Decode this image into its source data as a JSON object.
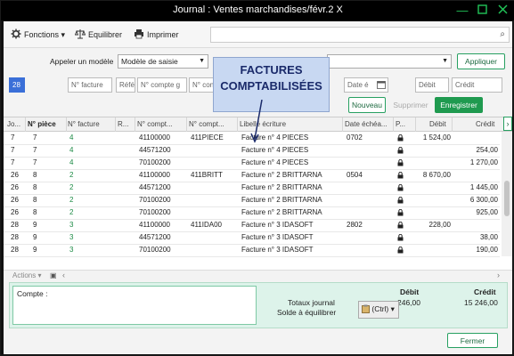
{
  "window": {
    "title": "Journal : Ventes marchandises/févr.2",
    "close_glyph": "X"
  },
  "toolbar": {
    "functions_label": "Fonctions",
    "balance_label": "Equilibrer",
    "print_label": "Imprimer"
  },
  "model": {
    "label": "Appeler un modèle",
    "selected": "Modèle de saisie",
    "apply_label": "Appliquer"
  },
  "filters": {
    "day": "28",
    "invoice_no": "N° facture",
    "reference": "Réfé",
    "account": "N° compte g",
    "account2": "N° con",
    "date": "Date é",
    "debit": "Débit",
    "credit": "Crédit"
  },
  "actions": {
    "new_label": "Nouveau",
    "delete_label": "Supprimer",
    "save_label": "Enregistrer"
  },
  "annotation": {
    "line1": "FACTURES",
    "line2": "COMPTABILISÉES"
  },
  "grid": {
    "headers": [
      "Jo...",
      "N° pièce",
      "N° facture",
      "R...",
      "N° compt...",
      "N° compt...",
      "Libellé écriture",
      "Date échéa...",
      "P...",
      "Débit",
      "Crédit"
    ],
    "rows": [
      {
        "day": "7",
        "piece": "7",
        "invoice": "4",
        "account": "41100000",
        "aux": "411PIECE",
        "label": "Facture n° 4 PIECES",
        "due": "0702",
        "debit": "1 524,00",
        "credit": ""
      },
      {
        "day": "7",
        "piece": "7",
        "invoice": "4",
        "account": "44571200",
        "aux": "",
        "label": "Facture n° 4 PIECES",
        "due": "",
        "debit": "",
        "credit": "254,00"
      },
      {
        "day": "7",
        "piece": "7",
        "invoice": "4",
        "account": "70100200",
        "aux": "",
        "label": "Facture n° 4 PIECES",
        "due": "",
        "debit": "",
        "credit": "1 270,00"
      },
      {
        "day": "26",
        "piece": "8",
        "invoice": "2",
        "account": "41100000",
        "aux": "411BRITT",
        "label": "Facture n° 2 BRITTARNA",
        "due": "0504",
        "debit": "8 670,00",
        "credit": ""
      },
      {
        "day": "26",
        "piece": "8",
        "invoice": "2",
        "account": "44571200",
        "aux": "",
        "label": "Facture n° 2 BRITTARNA",
        "due": "",
        "debit": "",
        "credit": "1 445,00"
      },
      {
        "day": "26",
        "piece": "8",
        "invoice": "2",
        "account": "70100200",
        "aux": "",
        "label": "Facture n° 2 BRITTARNA",
        "due": "",
        "debit": "",
        "credit": "6 300,00"
      },
      {
        "day": "26",
        "piece": "8",
        "invoice": "2",
        "account": "70100200",
        "aux": "",
        "label": "Facture n° 2 BRITTARNA",
        "due": "",
        "debit": "",
        "credit": "925,00"
      },
      {
        "day": "28",
        "piece": "9",
        "invoice": "3",
        "account": "41100000",
        "aux": "411IDA00",
        "label": "Facture n° 3 IDASOFT",
        "due": "2802",
        "debit": "228,00",
        "credit": ""
      },
      {
        "day": "28",
        "piece": "9",
        "invoice": "3",
        "account": "44571200",
        "aux": "",
        "label": "Facture n° 3 IDASOFT",
        "due": "",
        "debit": "",
        "credit": "38,00"
      },
      {
        "day": "28",
        "piece": "9",
        "invoice": "3",
        "account": "70100200",
        "aux": "",
        "label": "Facture n° 3 IDASOFT",
        "due": "",
        "debit": "",
        "credit": "190,00"
      }
    ]
  },
  "bottom": {
    "actions_label": "Actions"
  },
  "footer": {
    "account_label": "Compte :",
    "debit_header": "Débit",
    "credit_header": "Crédit",
    "totals_label": "Totaux journal",
    "balance_label": "Solde à équilibrer",
    "total_debit": "246,00",
    "total_credit": "15 246,00",
    "ctrl_label": "(Ctrl)"
  },
  "close_label": "Fermer",
  "colors": {
    "accent": "#1f9a4f",
    "footer_bg": "#ddf3ea",
    "window_controls": "#21c458"
  }
}
